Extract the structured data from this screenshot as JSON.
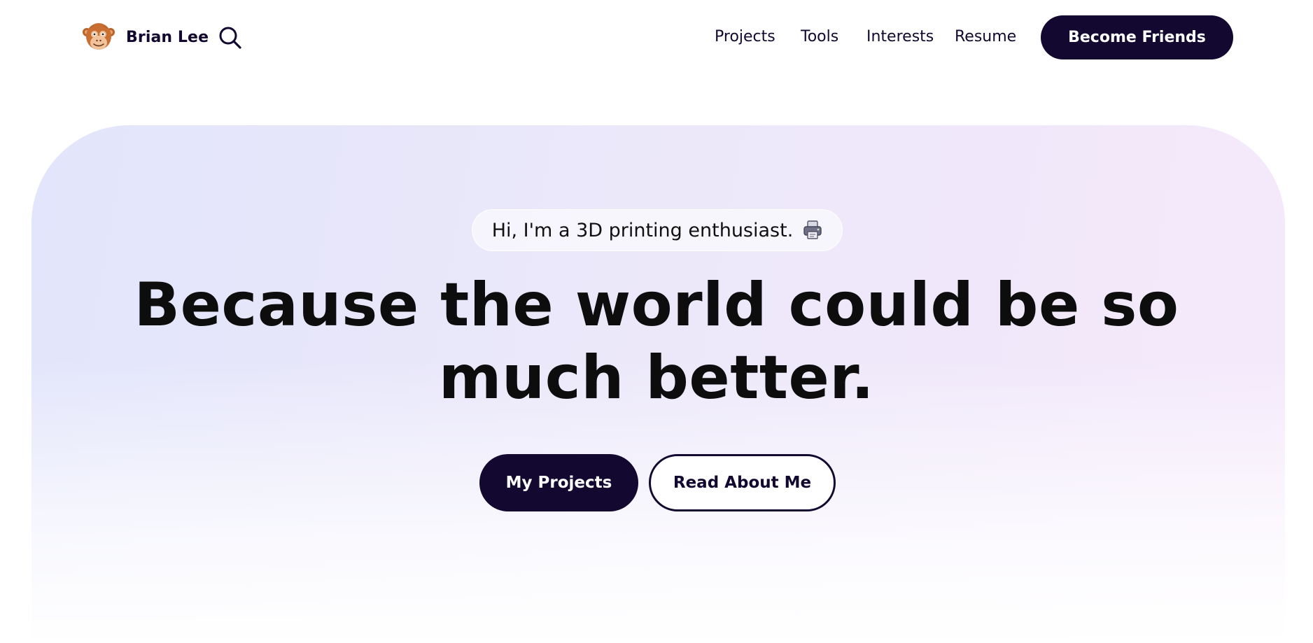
{
  "header": {
    "brand_name": "Brian Lee",
    "avatar_icon": "monkey-avatar-icon",
    "search_icon": "search-icon",
    "nav": [
      {
        "label": "Projects"
      },
      {
        "label": "Tools"
      },
      {
        "label": "Interests"
      },
      {
        "label": "Resume"
      }
    ],
    "cta_label": "Become Friends"
  },
  "hero": {
    "intro_text": "Hi, I'm a 3D printing enthusiast.",
    "intro_icon": "printer-icon",
    "headline": "Because the world could be so much better.",
    "primary_button": "My Projects",
    "secondary_button": "Read About Me"
  },
  "colors": {
    "brand_dark": "#13082f",
    "hero_gradient_start": "#e2e5fb",
    "hero_gradient_end": "#f5e9fb"
  }
}
